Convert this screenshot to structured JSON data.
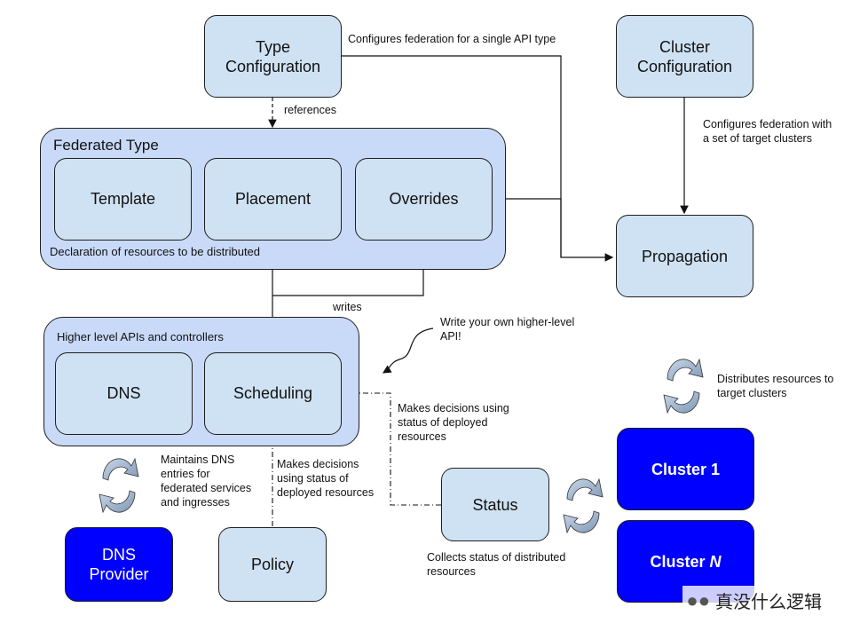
{
  "nodes": {
    "type_configuration": "Type\nConfiguration",
    "cluster_configuration": "Cluster\nConfiguration",
    "federated_type": {
      "title": "Federated Type",
      "children": [
        "Template",
        "Placement",
        "Overrides"
      ],
      "caption": "Declaration of resources to be distributed"
    },
    "propagation": "Propagation",
    "higher_level": {
      "title": "Higher level APIs and controllers",
      "children": [
        "DNS",
        "Scheduling"
      ]
    },
    "status": "Status",
    "cluster_1": "Cluster 1",
    "cluster_n_prefix": "Cluster ",
    "cluster_n_suffix": "N",
    "dns_provider": "DNS\nProvider",
    "policy": "Policy"
  },
  "labels": {
    "configures_api_type": "Configures federation for a single API type",
    "references": "references",
    "configures_clusters": "Configures federation with\na set of target clusters",
    "writes": "writes",
    "write_your_own": "Write your own higher-level\nAPI!",
    "distributes": "Distributes resources to\ntarget clusters",
    "decisions_status_right": "Makes decisions using\nstatus of deployed\nresources",
    "maintains_dns": "Maintains DNS\nentries for\nfederated services\nand ingresses",
    "decisions_status_policy": "Makes decisions\nusing status of\ndeployed resources",
    "collects_status": "Collects status of distributed\nresources"
  },
  "watermark": "真没什么逻辑",
  "colors": {
    "light_box": "#cfe2f3",
    "group_box": "#c9daf8",
    "cluster_box": "#0000ff",
    "cycle_fill": "#a9bfd9"
  }
}
